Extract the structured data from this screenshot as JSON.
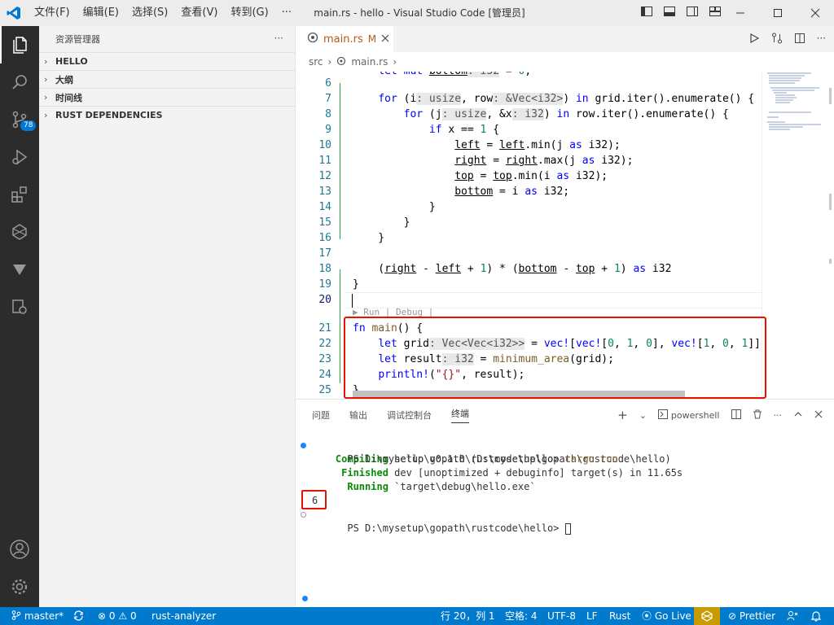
{
  "titlebar": {
    "menus": [
      "文件(F)",
      "编辑(E)",
      "选择(S)",
      "查看(V)",
      "转到(G)",
      "···"
    ],
    "window_title": "main.rs - hello - Visual Studio Code [管理员]"
  },
  "activity": {
    "source_control_badge": "78"
  },
  "sidebar": {
    "title": "资源管理器",
    "sections": [
      "HELLO",
      "大纲",
      "时间线",
      "RUST DEPENDENCIES"
    ]
  },
  "editor": {
    "tab": {
      "name": "main.rs",
      "modified_flag": "M"
    },
    "breadcrumb": [
      "src",
      "main.rs"
    ],
    "codelens": "▶ Run | Debug |"
  },
  "terminal": {
    "tabs": [
      "问题",
      "输出",
      "调试控制台",
      "终端"
    ],
    "shell": "powershell",
    "lines": [
      {
        "prompt": "PS D:\\mysetup\\gopath\\rustcode\\hello> ",
        "cmd": "cargo run"
      },
      {
        "label": "Compiling",
        "text": " hello v0.1.0 (D:\\mysetup\\gopath\\rustcode\\hello)"
      },
      {
        "label": "Finished",
        "text": " dev [unoptimized + debuginfo] target(s) in 11.65s"
      },
      {
        "label": "Running",
        "text": " `target\\debug\\hello.exe`"
      },
      {
        "text": "6"
      },
      {
        "prompt": "PS D:\\mysetup\\gopath\\rustcode\\hello> "
      }
    ]
  },
  "statusbar": {
    "branch": "master*",
    "errors": "0",
    "warnings": "0",
    "analyzer": "rust-analyzer",
    "position": "行 20，列 1",
    "spaces": "空格: 4",
    "encoding": "UTF-8",
    "eol": "LF",
    "language": "Rust",
    "golive": "Go Live",
    "prettier": "Prettier"
  }
}
